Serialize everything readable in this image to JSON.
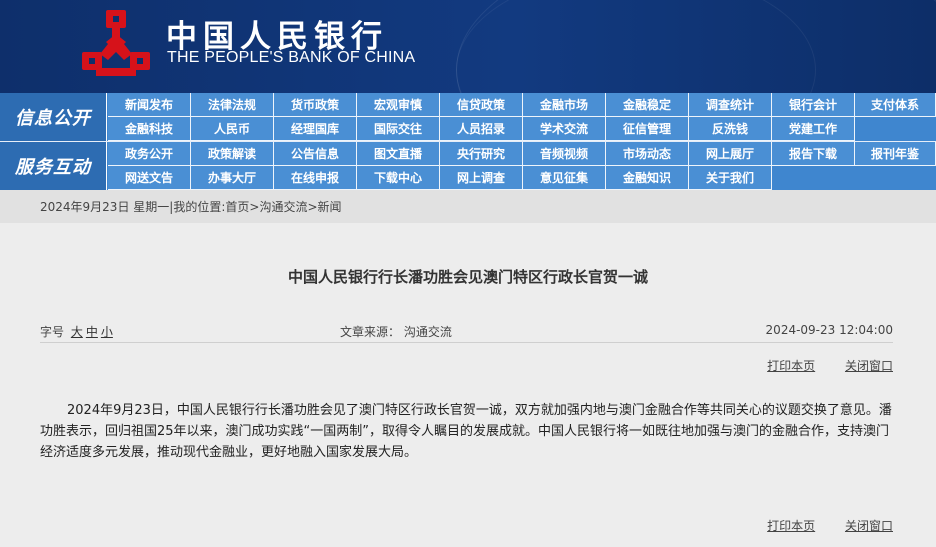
{
  "header": {
    "logo_cn": "中国人民银行",
    "logo_en": "THE PEOPLE'S BANK OF CHINA",
    "brand_color": "#d6121a"
  },
  "nav": {
    "section1": {
      "label": "信息公开",
      "items": [
        "新闻发布",
        "法律法规",
        "货币政策",
        "宏观审慎",
        "信贷政策",
        "金融市场",
        "金融稳定",
        "调查统计",
        "银行会计",
        "支付体系",
        "金融科技",
        "人民币",
        "经理国库",
        "国际交往",
        "人员招录",
        "学术交流",
        "征信管理",
        "反洗钱",
        "党建工作"
      ]
    },
    "section2": {
      "label": "服务互动",
      "items": [
        "政务公开",
        "政策解读",
        "公告信息",
        "图文直播",
        "央行研究",
        "音频视频",
        "市场动态",
        "网上展厅",
        "报告下载",
        "报刊年鉴",
        "网送文告",
        "办事大厅",
        "在线申报",
        "下载中心",
        "网上调查",
        "意见征集",
        "金融知识",
        "关于我们"
      ]
    }
  },
  "breadcrumb": {
    "date": "2024年9月23日",
    "weekday": "星期一",
    "sep": " | ",
    "location_label": "我的位置:",
    "home": "首页",
    "arrow": " > ",
    "level1": "沟通交流",
    "level2": "新闻"
  },
  "article": {
    "title": "中国人民银行行长潘功胜会见澳门特区行政长官贺一诚",
    "font_size_label": "字号",
    "font_large": "大",
    "font_medium": "中",
    "font_small": "小",
    "source": "文章来源：  沟通交流",
    "datetime": "2024-09-23 12:04:00",
    "print": "打印本页",
    "close": "关闭窗口",
    "body": "2024年9月23日，中国人民银行行长潘功胜会见了澳门特区行政长官贺一诚，双方就加强内地与澳门金融合作等共同关心的议题交换了意见。潘功胜表示，回归祖国25年以来，澳门成功实践“一国两制”，取得令人瞩目的发展成就。中国人民银行将一如既往地加强与澳门的金融合作，支持澳门经济适度多元发展，推动现代金融业，更好地融入国家发展大局。"
  }
}
